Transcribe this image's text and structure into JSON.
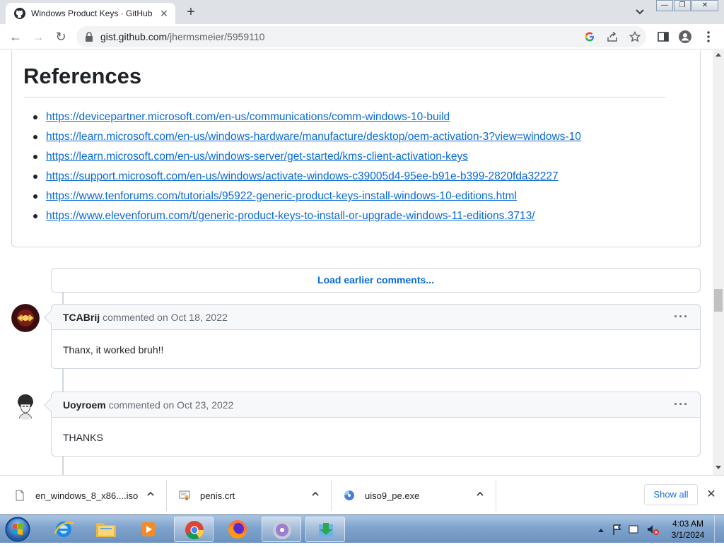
{
  "browser": {
    "tab_title": "Windows Product Keys · GitHub",
    "url_domain": "gist.github.com",
    "url_path": "/jhermsmeier/5959110"
  },
  "references": {
    "heading": "References",
    "links": [
      "https://devicepartner.microsoft.com/en-us/communications/comm-windows-10-build",
      "https://learn.microsoft.com/en-us/windows-hardware/manufacture/desktop/oem-activation-3?view=windows-10",
      "https://learn.microsoft.com/en-us/windows-server/get-started/kms-client-activation-keys",
      "https://support.microsoft.com/en-us/windows/activate-windows-c39005d4-95ee-b91e-b399-2820fda32227",
      "https://www.tenforums.com/tutorials/95922-generic-product-keys-install-windows-10-editions.html",
      "https://www.elevenforum.com/t/generic-product-keys-to-install-or-upgrade-windows-11-editions.3713/"
    ]
  },
  "load_earlier": "Load earlier comments...",
  "comments": [
    {
      "author": "TCABrij",
      "meta": "commented on Oct 18, 2022",
      "body": "Thanx, it worked bruh!!"
    },
    {
      "author": "Uoyroem",
      "meta": "commented on Oct 23, 2022",
      "body": "THANKS"
    }
  ],
  "downloads": {
    "items": [
      {
        "name": "en_windows_8_x86....iso",
        "icon": "file-icon"
      },
      {
        "name": "penis.crt",
        "icon": "certificate-icon"
      },
      {
        "name": "uiso9_pe.exe",
        "icon": "disc-installer-icon"
      }
    ],
    "show_all": "Show all"
  },
  "taskbar": {
    "time": "4:03 AM",
    "date": "3/1/2024"
  },
  "colors": {
    "link": "#0969da",
    "taskbar": "#7fa3cc"
  }
}
